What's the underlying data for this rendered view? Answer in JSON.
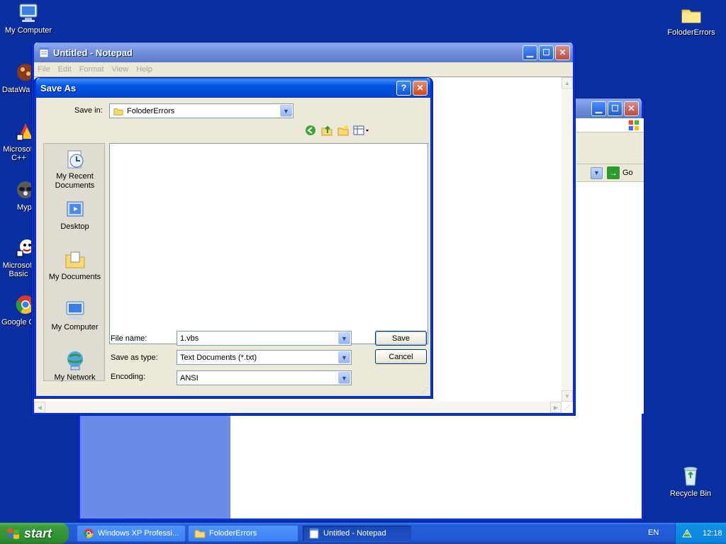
{
  "desktop": {
    "icons": [
      {
        "label": "My Computer",
        "icon": "computer-icon"
      },
      {
        "label": "DataWa",
        "icon": "datawarrior-icon"
      },
      {
        "label": "Microsoft C++",
        "icon": "visual-cpp-icon"
      },
      {
        "label": "Myp",
        "icon": "raccoon-icon"
      },
      {
        "label": "Microsoft Basic",
        "icon": "visual-basic-icon"
      },
      {
        "label": "Google C",
        "icon": "chrome-icon"
      },
      {
        "label": "FoloderErrors",
        "icon": "folder-icon"
      },
      {
        "label": "Recycle Bin",
        "icon": "recycle-bin-icon"
      }
    ]
  },
  "explorer_window": {
    "address_go_label": "Go"
  },
  "notepad": {
    "title": "Untitled - Notepad",
    "menu": [
      "File",
      "Edit",
      "Format",
      "View",
      "Help"
    ]
  },
  "save_dialog": {
    "title": "Save As",
    "save_in_label": "Save in:",
    "save_in_value": "FoloderErrors",
    "places": [
      "My Recent Documents",
      "Desktop",
      "My Documents",
      "My Computer",
      "My Network"
    ],
    "file_name_label": "File name:",
    "file_name_value": "1.vbs",
    "save_as_type_label": "Save as type:",
    "save_as_type_value": "Text Documents (*.txt)",
    "encoding_label": "Encoding:",
    "encoding_value": "ANSI",
    "save_button": "Save",
    "cancel_button": "Cancel",
    "help_button": "?",
    "close_button": "✕"
  },
  "taskbar": {
    "start_label": "start",
    "tasks": [
      {
        "label": "Windows XP Professi...",
        "icon": "chrome-icon"
      },
      {
        "label": "FoloderErrors",
        "icon": "folder-icon"
      },
      {
        "label": "Untitled - Notepad",
        "icon": "notepad-icon"
      }
    ],
    "language": "EN",
    "clock": "12:18"
  },
  "colors": {
    "desktop_bg": "#0a2fa0",
    "titlebar_active": "#0054e3",
    "window_face": "#ece9d8"
  }
}
